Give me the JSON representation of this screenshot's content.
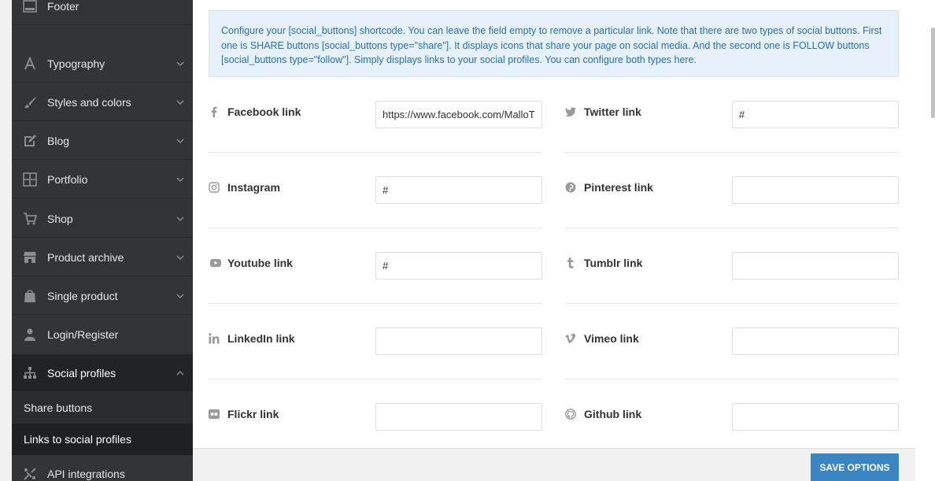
{
  "sidebar": {
    "items": [
      {
        "label": "Footer",
        "icon": "footer-icon"
      },
      {
        "label": "Typography",
        "icon": "typography-icon"
      },
      {
        "label": "Styles and colors",
        "icon": "brush-icon"
      },
      {
        "label": "Blog",
        "icon": "blog-icon"
      },
      {
        "label": "Portfolio",
        "icon": "portfolio-icon"
      },
      {
        "label": "Shop",
        "icon": "cart-icon"
      },
      {
        "label": "Product archive",
        "icon": "store-icon"
      },
      {
        "label": "Single product",
        "icon": "product-icon"
      },
      {
        "label": "Login/Register",
        "icon": "user-icon"
      },
      {
        "label": "Social profiles",
        "icon": "sitemap-icon"
      }
    ],
    "subitems": [
      {
        "label": "Share buttons"
      },
      {
        "label": "Links to social profiles"
      }
    ],
    "api": {
      "label": "API integrations",
      "icon": "api-icon"
    }
  },
  "notice": {
    "text": "Configure your [social_buttons] shortcode. You can leave the field empty to remove a particular link. Note that there are two types of social buttons. First one is SHARE buttons [social_buttons type=\"share\"]. It displays icons that share your page on social media. And the second one is FOLLOW buttons [social_buttons type=\"follow\"]. Simply displays links to your social profiles. You can configure both types here."
  },
  "fields": [
    {
      "label": "Facebook link",
      "icon": "facebook-icon",
      "value": "https://www.facebook.com/MalloThemes"
    },
    {
      "label": "Twitter link",
      "icon": "twitter-icon",
      "value": "#"
    },
    {
      "label": "Instagram",
      "icon": "instagram-icon",
      "value": "#"
    },
    {
      "label": "Pinterest link",
      "icon": "pinterest-icon",
      "value": ""
    },
    {
      "label": "Youtube link",
      "icon": "youtube-icon",
      "value": "#"
    },
    {
      "label": "Tumblr link",
      "icon": "tumblr-icon",
      "value": ""
    },
    {
      "label": "LinkedIn link",
      "icon": "linkedin-icon",
      "value": ""
    },
    {
      "label": "Vimeo link",
      "icon": "vimeo-icon",
      "value": ""
    },
    {
      "label": "Flickr link",
      "icon": "flickr-icon",
      "value": ""
    },
    {
      "label": "Github link",
      "icon": "github-icon",
      "value": ""
    }
  ],
  "save": {
    "label": "SAVE OPTIONS"
  },
  "colors": {
    "sidebar": "#333436",
    "accent": "#3b85c3",
    "notice_bg": "#e6f1fb",
    "notice_text": "#2a6fb0"
  }
}
